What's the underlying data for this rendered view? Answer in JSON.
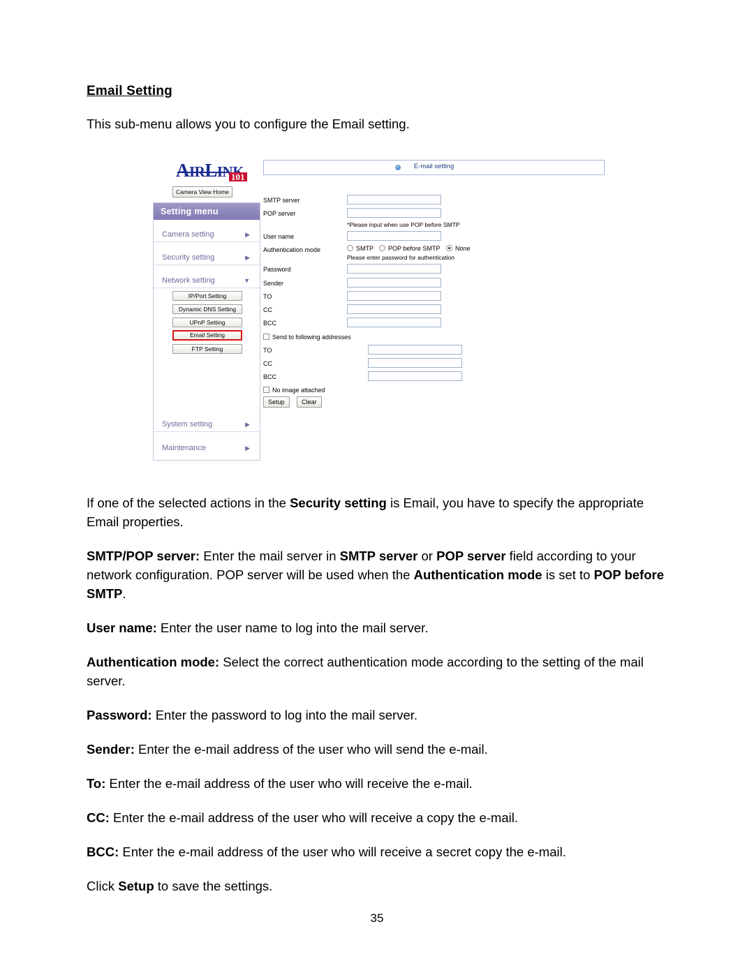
{
  "document": {
    "heading": "Email Setting",
    "intro": "This sub-menu allows you to configure the Email setting.",
    "page_number": "35",
    "paragraphs": {
      "p1_a": "If one of the selected actions in the ",
      "p1_b": "Security setting",
      "p1_c": " is Email, you have to specify the appropriate Email properties.",
      "p2_a": "SMTP/POP server:",
      "p2_b": " Enter the mail server in ",
      "p2_c": "SMTP server",
      "p2_d": " or ",
      "p2_e": "POP server",
      "p2_f": " field according to your network configuration. POP server will be used when the ",
      "p2_g": "Authentication mode",
      "p2_h": " is set to ",
      "p2_i": "POP before SMTP",
      "p2_j": ".",
      "p3_a": "User name:",
      "p3_b": " Enter the user name to log into the mail server.",
      "p4_a": "Authentication mode:",
      "p4_b": " Select the correct authentication mode according to the setting of the mail server.",
      "p5_a": "Password:",
      "p5_b": " Enter the password to log into the mail server.",
      "p6_a": "Sender:",
      "p6_b": " Enter the e-mail address of the user who will send the e-mail.",
      "p7_a": "To:",
      "p7_b": " Enter the e-mail address of the user who will receive the e-mail.",
      "p8_a": "CC:",
      "p8_b": " Enter the e-mail address of the user who will receive a copy the e-mail.",
      "p9_a": "BCC:",
      "p9_b": " Enter the e-mail address of the user who will receive a secret copy the e-mail.",
      "p10_a": "Click ",
      "p10_b": "Setup",
      "p10_c": " to save the settings."
    }
  },
  "screenshot": {
    "brand": {
      "logo_text_a": "A",
      "logo_text_b": "IR",
      "logo_text_c": "L",
      "logo_text_d": "INK",
      "logo_badge": "101"
    },
    "camera_view_home_button": "Camera View Home",
    "menu": {
      "title": "Setting menu",
      "items": [
        {
          "label": "Camera setting",
          "arrow": "▶"
        },
        {
          "label": "Security setting",
          "arrow": "▶"
        },
        {
          "label": "Network setting",
          "arrow": "▼"
        },
        {
          "label": "System setting",
          "arrow": "▶"
        },
        {
          "label": "Maintenance",
          "arrow": "▶"
        }
      ],
      "sub_items": [
        {
          "label": "IP/Port Setting",
          "selected": false
        },
        {
          "label": "Dynamic DNS Setting",
          "selected": false
        },
        {
          "label": "UPnP Setting",
          "selected": false
        },
        {
          "label": "Email Setting",
          "selected": true
        },
        {
          "label": "FTP Setting",
          "selected": false
        }
      ]
    },
    "form": {
      "title": "E-mail setting",
      "labels": {
        "smtp_server": "SMTP server",
        "pop_server": "POP server",
        "user_name": "User name",
        "authentication_mode": "Authentication mode",
        "password": "Password",
        "sender": "Sender",
        "to": "TO",
        "cc": "CC",
        "bcc": "BCC",
        "to2": "TO",
        "cc2": "CC",
        "bcc2": "BCC"
      },
      "notes": {
        "pop_note": "*Please input when use POP before SMTP",
        "password_note": "Please enter password for authentication"
      },
      "radios": [
        {
          "label": "SMTP",
          "checked": false
        },
        {
          "label": "POP before SMTP",
          "checked": false
        },
        {
          "label": "None",
          "checked": true
        }
      ],
      "checkboxes": [
        {
          "label": "Send to following addresses",
          "checked": false
        },
        {
          "label": "No image attached",
          "checked": false
        }
      ],
      "buttons": [
        {
          "label": "Setup"
        },
        {
          "label": "Clear"
        }
      ],
      "values": {
        "smtp_server": "",
        "pop_server": "",
        "user_name": "",
        "password": "",
        "sender": "",
        "to": "",
        "cc": "",
        "bcc": "",
        "to2": "",
        "cc2": "",
        "bcc2": ""
      }
    }
  }
}
